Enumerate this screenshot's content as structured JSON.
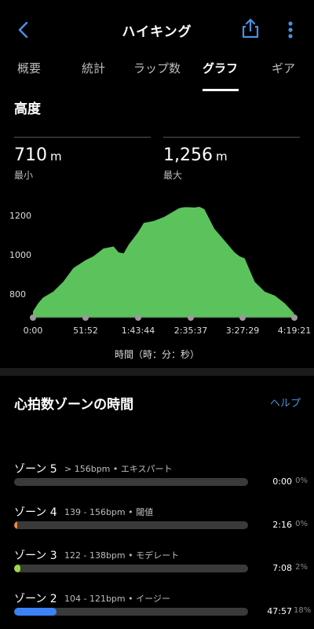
{
  "header": {
    "title": "ハイキング"
  },
  "tabs": [
    {
      "label": "概要"
    },
    {
      "label": "統計"
    },
    {
      "label": "ラップ数"
    },
    {
      "label": "グラフ"
    },
    {
      "label": "ギア"
    }
  ],
  "active_tab": "グラフ",
  "elevation": {
    "section_title": "高度",
    "min": {
      "value": "710",
      "unit": "m",
      "label": "最小"
    },
    "max": {
      "value": "1,256",
      "unit": "m",
      "label": "最大"
    }
  },
  "chart_data": {
    "type": "area",
    "xlabel": "時間（時：分：秒）",
    "x_ticks": [
      "0:00",
      "51:52",
      "1:43:44",
      "2:35:37",
      "3:27:29",
      "4:19:21"
    ],
    "y_ticks": [
      800,
      1000,
      1200
    ],
    "ylim": [
      650,
      1300
    ],
    "x_minutes": [
      0,
      5,
      10,
      20,
      30,
      40,
      52,
      60,
      70,
      80,
      85,
      90,
      95,
      104,
      110,
      120,
      130,
      140,
      145,
      150,
      155,
      160,
      165,
      170,
      180,
      190,
      200,
      205,
      210,
      220,
      230,
      240,
      250,
      259
    ],
    "y": [
      720,
      760,
      790,
      820,
      870,
      940,
      980,
      1000,
      1040,
      1050,
      1020,
      1015,
      1060,
      1120,
      1170,
      1180,
      1200,
      1230,
      1245,
      1250,
      1250,
      1248,
      1252,
      1240,
      1140,
      1080,
      1020,
      1000,
      990,
      870,
      820,
      800,
      760,
      710
    ],
    "color": "#5cc25c"
  },
  "hr_zones": {
    "section_title": "心拍数ゾーンの時間",
    "help_label": "ヘルプ",
    "zones": [
      {
        "name": "ゾーン 5",
        "desc": "> 156bpm • エキスパート",
        "time": "0:00",
        "pct": "0%",
        "fraction": 0,
        "color": "#e24a4a"
      },
      {
        "name": "ゾーン 4",
        "desc": "139 - 156bpm • 閾値",
        "time": "2:16",
        "pct": "0%",
        "fraction": 0.009,
        "color": "#f0883a"
      },
      {
        "name": "ゾーン 3",
        "desc": "122 - 138bpm • モデレート",
        "time": "7:08",
        "pct": "2%",
        "fraction": 0.027,
        "color": "#9ad84a"
      },
      {
        "name": "ゾーン 2",
        "desc": "104 - 121bpm • イージー",
        "time": "47:57",
        "pct": "18%",
        "fraction": 0.18,
        "color": "#3b82f6"
      }
    ]
  }
}
